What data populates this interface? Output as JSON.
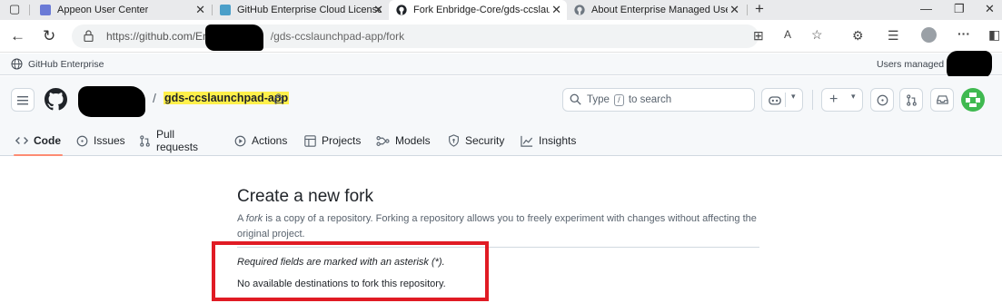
{
  "browser": {
    "tabs": [
      {
        "title": "Appeon User Center",
        "active": false
      },
      {
        "title": "GitHub Enterprise Cloud License F",
        "active": false
      },
      {
        "title": "Fork Enbridge-Core/gds-ccslaunc",
        "active": true
      },
      {
        "title": "About Enterprise Managed Users",
        "active": false
      }
    ],
    "new_tab": "+",
    "close_glyph": "✕",
    "window": {
      "minimize": "—",
      "restore": "❐",
      "close": "✕"
    },
    "url_visible_prefix": "https://github.com/En",
    "url_visible_suffix": "/gds-ccslaunchpad-app/fork"
  },
  "enterprise_banner": {
    "left": "GitHub Enterprise",
    "right": "Users managed by"
  },
  "header": {
    "repo_separator": "/",
    "repo_name": "gds-ccslaunchpad-app",
    "search": {
      "before": "Type",
      "key": "/",
      "after": "to search"
    },
    "plus": "+"
  },
  "repo_nav": [
    {
      "label": "Code",
      "icon": "code-icon",
      "selected": true
    },
    {
      "label": "Issues",
      "icon": "issue-icon",
      "selected": false
    },
    {
      "label": "Pull requests",
      "icon": "pull-request-icon",
      "selected": false
    },
    {
      "label": "Actions",
      "icon": "actions-play-icon",
      "selected": false
    },
    {
      "label": "Projects",
      "icon": "table-icon",
      "selected": false
    },
    {
      "label": "Models",
      "icon": "models-icon",
      "selected": false
    },
    {
      "label": "Security",
      "icon": "shield-icon",
      "selected": false
    },
    {
      "label": "Insights",
      "icon": "graph-icon",
      "selected": false
    }
  ],
  "main": {
    "title": "Create a new fork",
    "desc_prefix": "A ",
    "desc_em": "fork",
    "desc_rest": " is a copy of a repository. Forking a repository allows you to freely experiment with changes without affecting the original project.",
    "required_note": "Required fields are marked with an asterisk (*).",
    "no_destinations": "No available destinations to fork this repository."
  },
  "colors": {
    "highlight": "#fff04a",
    "annotation_red": "#e01b24",
    "tab_underline": "#fd8c73"
  }
}
